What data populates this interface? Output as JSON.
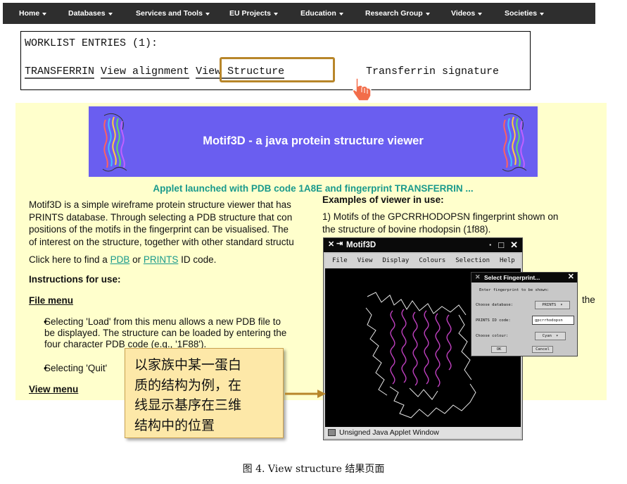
{
  "nav": {
    "items": [
      "Home",
      "Databases",
      "Services and Tools",
      "EU Projects",
      "Education",
      "Research Group",
      "Videos",
      "Societies"
    ]
  },
  "worklist": {
    "heading": "WORKLIST ENTRIES (1):",
    "entry": "TRANSFERRIN",
    "view_alignment": "View alignment",
    "view_structure": "View Structure",
    "signature": "Transferrin signature"
  },
  "applet_page": {
    "banner_title": "Motif3D - a java protein structure viewer",
    "launched_text": "Applet launched with PDB code 1A8E and fingerprint TRANSFERRIN ...",
    "intro_lines": [
      "Motif3D is a simple wireframe protein structure viewer that has",
      "PRINTS database.  Through selecting a PDB structure that con",
      "positions of the motifs in the fingerprint can be visualised.  The",
      "of interest on the structure, together with other standard structu"
    ],
    "find_prefix": "Click here to find a ",
    "pdb_link": "PDB",
    "find_or": " or ",
    "prints_link": "PRINTS",
    "find_suffix": " ID code.",
    "instructions_heading": "Instructions for use:",
    "file_menu_heading": "File menu",
    "bullet_load_lines": [
      "Selecting 'Load' from this menu allows a new PDB file to",
      "be displayed. The structure can be loaded by entering the",
      "four character PDB code (e.g., '1F88')."
    ],
    "bullet_quit": "Selecting 'Quit'",
    "view_menu_heading": "View menu",
    "examples_heading": "Examples of viewer in use:",
    "example1_lines": [
      "1) Motifs of the GPCRRHODOPSN fingerprint shown on",
      "the structure of bovine rhodopsin (1f88)."
    ],
    "trailing_word": "the"
  },
  "applet_window": {
    "title": "Motif3D",
    "controls": [
      "·",
      "□",
      "✕"
    ],
    "menus": [
      "File",
      "View",
      "Display",
      "Colours",
      "Selection",
      "Help"
    ],
    "status": "Unsigned Java Applet Window"
  },
  "dialog": {
    "title": "Select Fingerprint...",
    "prompt": "Enter fingerprint to be shown:",
    "database_label": "Choose database:",
    "database_value": "PRINTS",
    "id_label": "PRINTS ID code:",
    "id_value": "gpcrrhodopsn",
    "colour_label": "Choose colour:",
    "colour_value": "Cyan",
    "ok_label": "OK",
    "cancel_label": "Cancel"
  },
  "callout": {
    "lines": [
      "以家族中某一蛋白",
      "质的结构为例，在",
      "线显示基序在三维",
      "结构中的位置"
    ]
  },
  "caption": "图 4. View structure 结果页面",
  "colors": {
    "nav_bg": "#2e2e2e",
    "banner": "#6a5ef0",
    "page_bg": "#ffffcc",
    "link_teal": "#1a9a8c",
    "highlight": "#b8862a",
    "callout_bg": "#fde8a8",
    "motif_magenta": "#c040c0"
  }
}
